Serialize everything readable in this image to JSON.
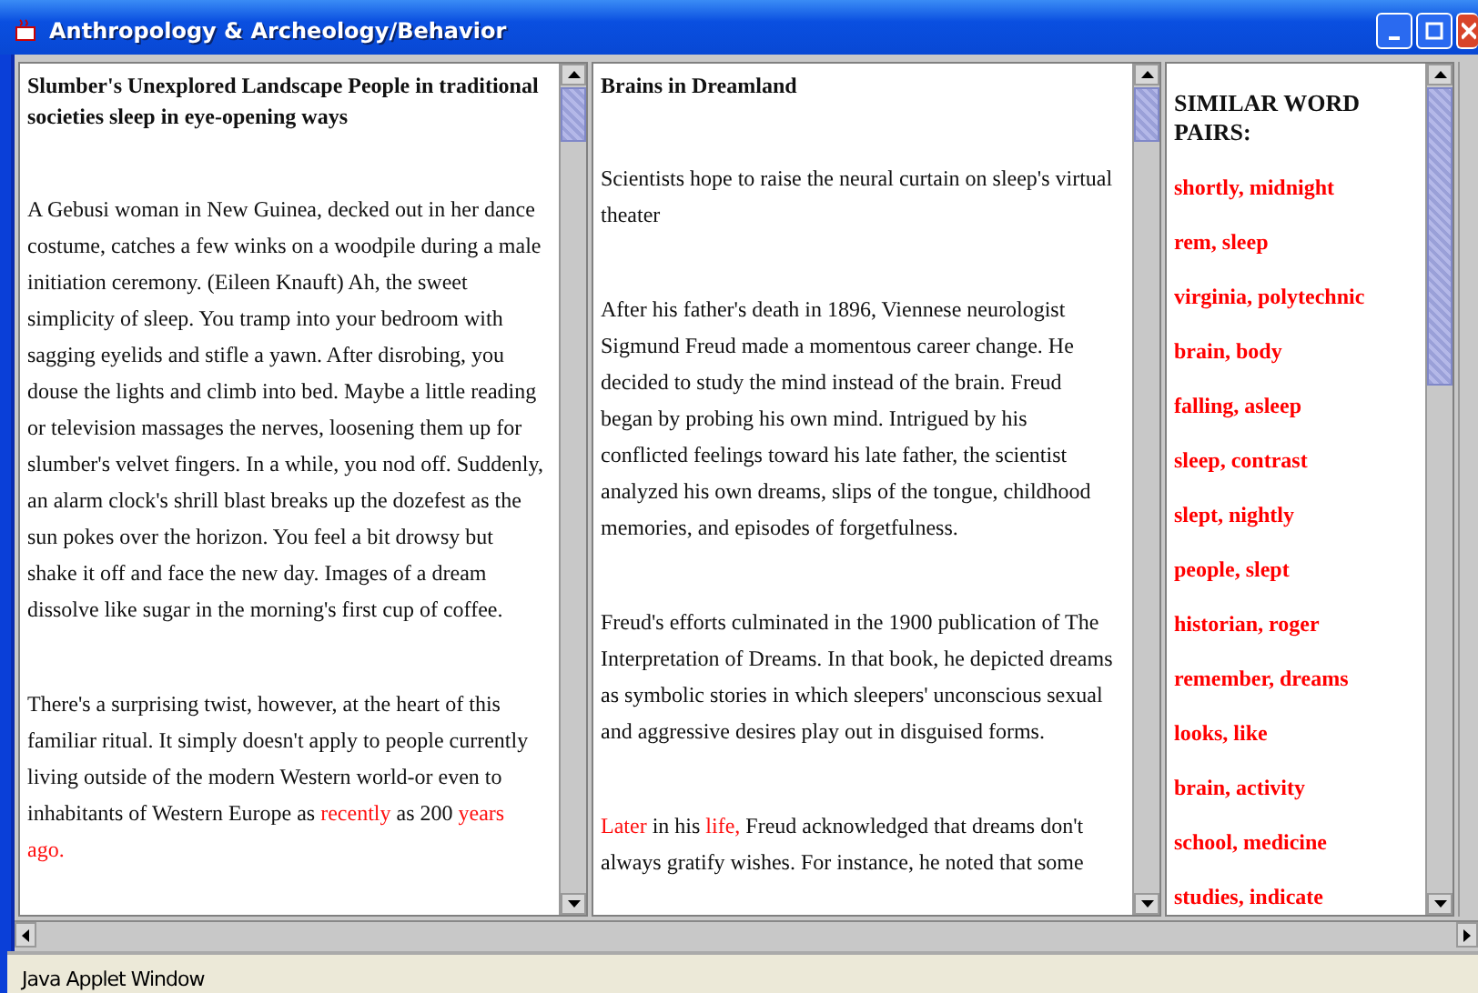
{
  "window": {
    "title": "Anthropology & Archeology/Behavior"
  },
  "panels": [
    {
      "title": "Slumber's Unexplored Landscape People in traditional societies sleep in eye-opening ways",
      "paragraphs": [
        [
          {
            "text": "A Gebusi woman in New Guinea, decked out in her dance costume, catches a few winks on a woodpile during a male initiation ceremony. (Eileen Knauft) Ah, the sweet simplicity of sleep. You tramp into your bedroom with sagging eyelids and stifle a yawn. After disrobing, you douse the lights and climb into bed. Maybe a little reading or television massages the nerves, loosening them up for slumber's velvet fingers. In a while, you nod off. Suddenly, an alarm clock's shrill blast breaks up the dozefest as the sun pokes over the horizon. You feel a bit drowsy but shake it off and face the new day. Images of a dream dissolve like sugar in the morning's first cup of coffee.",
            "highlighted": false
          }
        ],
        [
          {
            "text": "There's a surprising twist, however, at the heart of this familiar ritual. It simply doesn't apply to people currently living outside of the modern Western world-or even to inhabitants of Western Europe as ",
            "highlighted": false
          },
          {
            "text": "recently",
            "highlighted": true
          },
          {
            "text": " as 200 ",
            "highlighted": false
          },
          {
            "text": "years ago.",
            "highlighted": true
          }
        ]
      ]
    },
    {
      "title": "Brains in Dreamland",
      "paragraphs": [
        [
          {
            "text": "Scientists hope to raise the neural curtain on sleep's virtual theater",
            "highlighted": false
          }
        ],
        [
          {
            "text": "After his father's death in 1896, Viennese neurologist Sigmund Freud made a momentous career change. He decided to study the mind instead of the brain. Freud began by probing his own mind. Intrigued by his conflicted feelings toward his late father, the scientist analyzed his own dreams, slips of the tongue, childhood memories, and episodes of forgetfulness.",
            "highlighted": false
          }
        ],
        [
          {
            "text": "Freud's efforts culminated in the 1900 publication of The Interpretation of Dreams. In that book, he depicted dreams as symbolic stories in which sleepers' unconscious sexual and aggressive desires play out in disguised forms.",
            "highlighted": false
          }
        ],
        [
          {
            "text": "Later",
            "highlighted": true
          },
          {
            "text": " in his ",
            "highlighted": false
          },
          {
            "text": "life,",
            "highlighted": true
          },
          {
            "text": " Freud acknowledged that dreams don't always gratify wishes. For instance, he noted that some",
            "highlighted": false
          }
        ]
      ]
    }
  ],
  "word_pairs": {
    "heading": "SIMILAR WORD PAIRS:",
    "pairs": [
      "shortly, midnight",
      "rem, sleep",
      "virginia, polytechnic",
      "brain, body",
      "falling, asleep",
      "sleep, contrast",
      "slept, nightly",
      "people, slept",
      "historian, roger",
      "remember, dreams",
      "looks, like",
      "brain, activity",
      "school, medicine",
      "studies, indicate"
    ]
  },
  "status_bar": "Java Applet Window"
}
